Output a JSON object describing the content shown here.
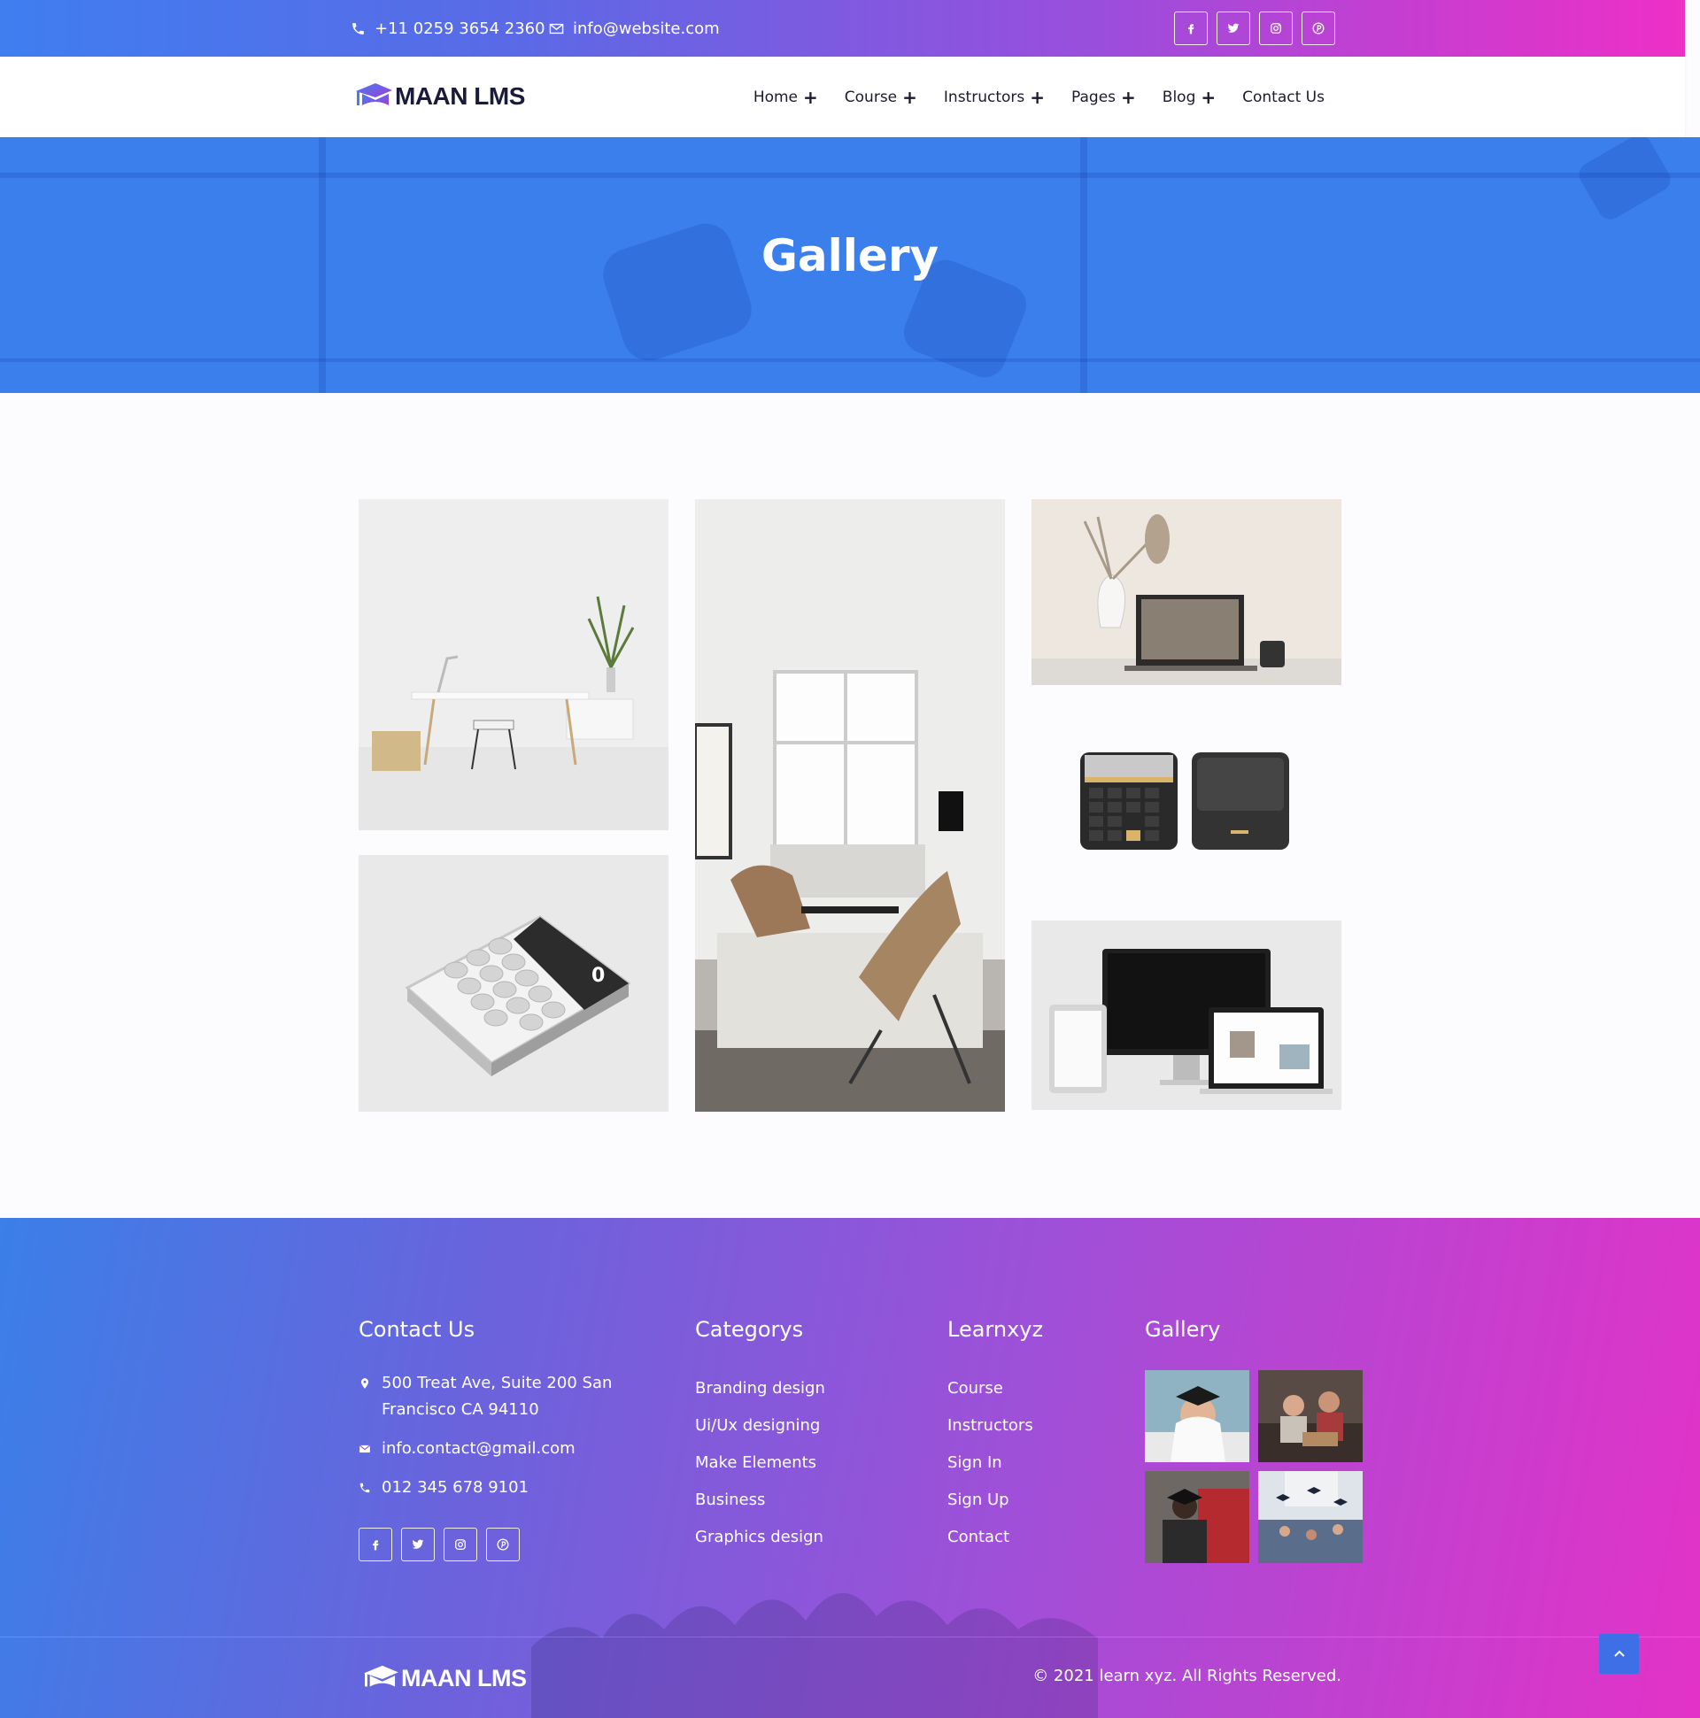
{
  "topbar": {
    "phone": "+11 0259 3654 2360",
    "email": "info@website.com",
    "social": [
      "facebook-icon",
      "twitter-icon",
      "instagram-icon",
      "pinterest-icon"
    ]
  },
  "header": {
    "logo_text": "MAAN LMS",
    "nav": [
      {
        "label": "Home",
        "has_submenu": true
      },
      {
        "label": "Course",
        "has_submenu": true
      },
      {
        "label": "Instructors",
        "has_submenu": true
      },
      {
        "label": "Pages",
        "has_submenu": true
      },
      {
        "label": "Blog",
        "has_submenu": true
      },
      {
        "label": "Contact Us",
        "has_submenu": false
      }
    ]
  },
  "banner": {
    "title": "Gallery"
  },
  "gallery": {
    "images": [
      {
        "name": "white-desk-workspace-photo"
      },
      {
        "name": "living-room-interior-photo"
      },
      {
        "name": "laptop-vase-photo"
      },
      {
        "name": "calculator-photo"
      },
      {
        "name": "black-calculator-speaker-photo"
      },
      {
        "name": "responsive-devices-photo"
      }
    ]
  },
  "footer": {
    "contact": {
      "heading": "Contact Us",
      "address": "500 Treat Ave, Suite 200 San Francisco CA 94110",
      "email": "info.contact@gmail.com",
      "phone": "012 345 678 9101"
    },
    "categories": {
      "heading": "Categorys",
      "links": [
        "Branding design",
        "Ui/Ux designing",
        "Make Elements",
        "Business",
        "Graphics design"
      ]
    },
    "learn": {
      "heading": "Learnxyz",
      "links": [
        "Course",
        "Instructors",
        "Sign In",
        "Sign Up",
        "Contact"
      ]
    },
    "gallery": {
      "heading": "Gallery"
    },
    "logo_text": "MAAN LMS",
    "copyright": "© 2021 learn xyz. All Rights Reserved."
  },
  "colors": {
    "accent_blue": "#3a7fec",
    "accent_pink": "#ee2fc6",
    "brand_purple": "#7b3fe4"
  }
}
